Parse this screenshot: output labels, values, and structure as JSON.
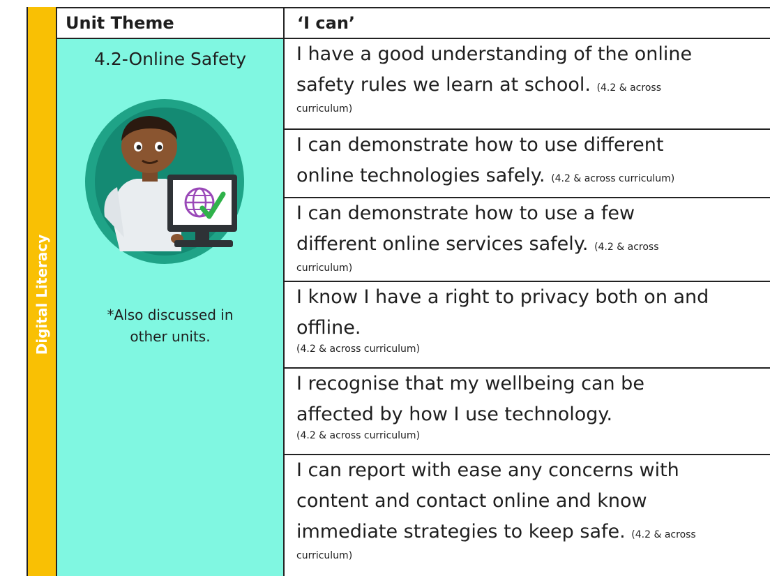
{
  "strand": {
    "label": "Digital Literacy"
  },
  "header": {
    "theme": "Unit Theme",
    "ican": "‘I can’"
  },
  "theme": {
    "title": "4.2-Online Safety",
    "note_line1": "*Also discussed in",
    "note_line2": "other units."
  },
  "statements": [
    {
      "l1": "I have a good understanding of the online",
      "l2": "safety rules we learn at school.",
      "n2": "(4.2 & across",
      "n3": "curriculum)"
    },
    {
      "l1": "I can demonstrate how to use different",
      "l2": "online technologies safely.",
      "n2": "(4.2 & across curriculum)"
    },
    {
      "l1": "I can demonstrate how to use a few",
      "l2": "different online services safely.",
      "n2": "(4.2 & across",
      "n3": "curriculum)"
    },
    {
      "l1": "I know I have a right to privacy both on and",
      "l2": "offline.",
      "n3": "(4.2 & across curriculum)"
    },
    {
      "l1": "I recognise that my wellbeing can be",
      "l2": "affected by how I use technology.",
      "n3": "(4.2 & across curriculum)"
    },
    {
      "l1": "I can report with ease any concerns with",
      "l2": "content and contact online and know",
      "l3": "immediate strategies to keep safe.",
      "n3": "(4.2 & across",
      "n4": "curriculum)"
    }
  ],
  "colors": {
    "strand": "#f9c004",
    "theme_bg": "#80f7e1",
    "illustration_ring": "#1fa387"
  },
  "icons": {
    "illustration": "boy-at-computer-icon",
    "screen": "globe-check-icon"
  }
}
